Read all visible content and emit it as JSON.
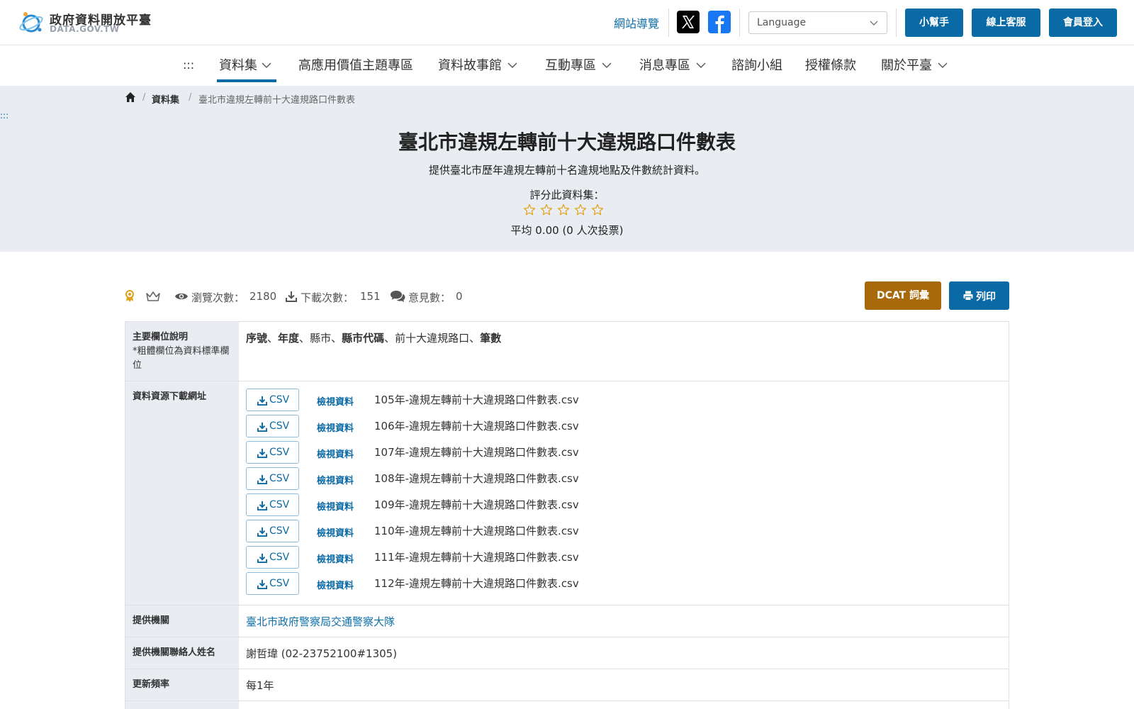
{
  "header": {
    "logo_title": "政府資料開放平臺",
    "logo_sub": "DATA.GOV.TW",
    "sitemap": "網站導覽",
    "language_placeholder": "Language",
    "buttons": {
      "helper": "小幫手",
      "service": "線上客服",
      "login": "會員登入"
    }
  },
  "nav": {
    "skip": ":::",
    "items": [
      {
        "label": "資料集",
        "dropdown": true,
        "active": true
      },
      {
        "label": "高應用價值主題專區",
        "dropdown": false
      },
      {
        "label": "資料故事館",
        "dropdown": true
      },
      {
        "label": "互動專區",
        "dropdown": true
      },
      {
        "label": "消息專區",
        "dropdown": true
      },
      {
        "label": "諮詢小組",
        "dropdown": false
      },
      {
        "label": "授權條款",
        "dropdown": false
      },
      {
        "label": "關於平臺",
        "dropdown": true
      }
    ]
  },
  "breadcrumb": {
    "home": "home",
    "sep": "/",
    "level1": "資料集",
    "current": "臺北市違規左轉前十大違規路口件數表"
  },
  "side_skip": ":::",
  "dataset": {
    "title": "臺北市違規左轉前十大違規路口件數表",
    "description": "提供臺北市歷年違規左轉前十名違規地點及件數統計資料。",
    "rate_label": "評分此資料集：",
    "rating_value": 0,
    "rating_max": 5,
    "avg_text": "平均 0.00 (0 人次投票)"
  },
  "stats": {
    "views_label": "瀏覽次數：",
    "views": "2180",
    "downloads_label": "下載次數：",
    "downloads": "151",
    "comments_label": "意見數：",
    "comments": "0",
    "dcat": "DCAT 詞彙",
    "print": "列印"
  },
  "table": {
    "fields_header": "主要欄位說明",
    "fields_note": "*粗體欄位為資料標準欄位",
    "fields": [
      {
        "name": "序號",
        "bold": true
      },
      {
        "name": "年度",
        "bold": true
      },
      {
        "name": "縣市",
        "bold": false
      },
      {
        "name": "縣市代碼",
        "bold": true
      },
      {
        "name": "前十大違規路口",
        "bold": false
      },
      {
        "name": "筆數",
        "bold": true
      }
    ],
    "resources_header": "資料資源下載網址",
    "resources": [
      {
        "format": "CSV",
        "view": "檢視資料",
        "file": "105年-違規左轉前十大違規路口件數表.csv"
      },
      {
        "format": "CSV",
        "view": "檢視資料",
        "file": "106年-違規左轉前十大違規路口件數表.csv"
      },
      {
        "format": "CSV",
        "view": "檢視資料",
        "file": "107年-違規左轉前十大違規路口件數表.csv"
      },
      {
        "format": "CSV",
        "view": "檢視資料",
        "file": "108年-違規左轉前十大違規路口件數表.csv"
      },
      {
        "format": "CSV",
        "view": "檢視資料",
        "file": "109年-違規左轉前十大違規路口件數表.csv"
      },
      {
        "format": "CSV",
        "view": "檢視資料",
        "file": "110年-違規左轉前十大違規路口件數表.csv"
      },
      {
        "format": "CSV",
        "view": "檢視資料",
        "file": "111年-違規左轉前十大違規路口件數表.csv"
      },
      {
        "format": "CSV",
        "view": "檢視資料",
        "file": "112年-違規左轉前十大違規路口件數表.csv"
      }
    ],
    "agency_header": "提供機關",
    "agency": "臺北市政府警察局交通警察大隊",
    "contact_header": "提供機關聯絡人姓名",
    "contact": "謝哲瑋 (02-23752100#1305)",
    "frequency_header": "更新頻率",
    "frequency": "每1年"
  },
  "colors": {
    "primary": "#0a6aa5",
    "dcat": "#a8690a",
    "hero_bg": "#e9edf2",
    "star": "#e0a21b"
  }
}
